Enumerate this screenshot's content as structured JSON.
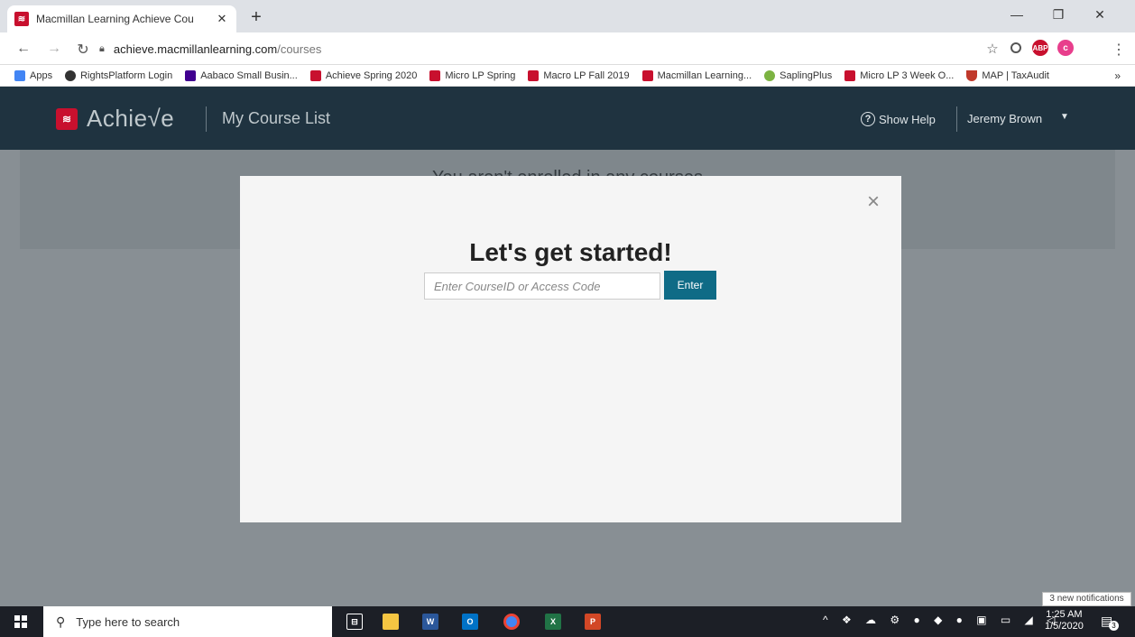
{
  "browser": {
    "tab_title": "Macmillan Learning Achieve Cou",
    "tab_close": "✕",
    "new_tab": "+",
    "url_host": "achieve.macmillanlearning.com",
    "url_path": "/courses",
    "bookmarks": [
      {
        "label": "Apps",
        "color": "#e8710a"
      },
      {
        "label": "RightsPlatform Login",
        "color": "#333"
      },
      {
        "label": "Aabaco Small Busin...",
        "color": "#400090"
      },
      {
        "label": "Achieve Spring 2020",
        "color": "#c8102e"
      },
      {
        "label": "Micro LP Spring",
        "color": "#c8102e"
      },
      {
        "label": "Macro LP Fall 2019",
        "color": "#c8102e"
      },
      {
        "label": "Macmillan Learning...",
        "color": "#c8102e"
      },
      {
        "label": "SaplingPlus",
        "color": "#7cb342"
      },
      {
        "label": "Micro LP 3 Week O...",
        "color": "#c8102e"
      },
      {
        "label": "MAP | TaxAudit",
        "color": "#c0392b"
      }
    ],
    "bookmarks_more": "»"
  },
  "app": {
    "logo_text": "Achie√e",
    "header_title": "My Course List",
    "help_label": "Show Help",
    "user_name": "Jeremy Brown",
    "background_message": "You aren't enrolled in any courses"
  },
  "modal": {
    "title": "Let's get started!",
    "input_placeholder": "Enter CourseID or Access Code",
    "enter_label": "Enter",
    "close_glyph": "×"
  },
  "taskbar": {
    "search_placeholder": "Type here to search",
    "time": "1:25 AM",
    "date": "1/5/2020",
    "notifications_tooltip": "3 new notifications",
    "notification_count": "3"
  }
}
